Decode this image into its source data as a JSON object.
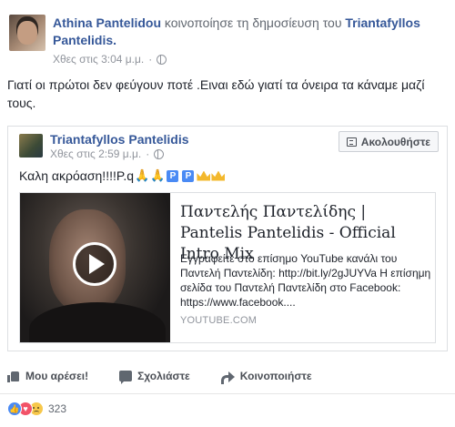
{
  "post": {
    "sharer_name": "Athina Pantelidou",
    "action_text": "κοινοποίησε τη δημοσίευση του",
    "original_author": "Triantafyllos Pantelidis.",
    "timestamp": "Χθες στις 3:04 μ.μ.",
    "body": "Γιατί οι πρώτοι δεν φεύγουν ποτέ .Ειναι εδώ γιατί τα όνειρα τα κάναμε μαζί τους."
  },
  "shared": {
    "author": "Triantafyllos Pantelidis",
    "timestamp": "Χθες στις 2:59 μ.μ.",
    "follow_label": "Ακολουθήστε",
    "text": "Καλη ακρόαση!!!!P.q",
    "emoji_pray": "🙏",
    "p_badge": "P",
    "link": {
      "title": "Παντελής Παντελίδης | Pantelis Pantelidis - Official Intro Mix",
      "description": "Εγγραφείτε στο επίσημο YouTube κανάλι του Παντελή Παντελίδη: http://bit.ly/2gJUYVa Η επίσημη σελίδα του Παντελή Παντελίδη στο Facebook: https://www.facebook....",
      "source": "YOUTUBE.COM"
    }
  },
  "actions": {
    "like": "Μου αρέσει!",
    "comment": "Σχολιάστε",
    "share": "Κοινοποιήστε"
  },
  "reactions": {
    "count": "323"
  },
  "colors": {
    "link_blue": "#365899",
    "meta_gray": "#90949c",
    "like_blue": "#4a8af4"
  }
}
